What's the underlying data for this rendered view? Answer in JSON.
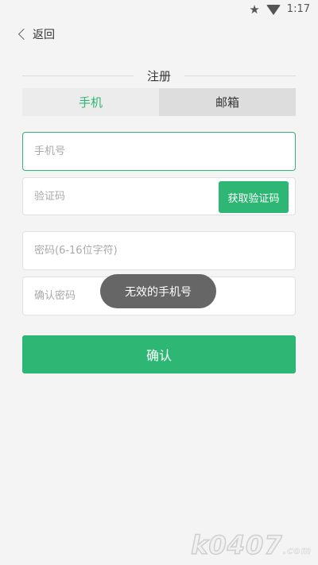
{
  "status_bar": {
    "time": "1:17",
    "icons": [
      "star-icon",
      "wifi-icon"
    ]
  },
  "nav": {
    "back_label": "返回"
  },
  "page": {
    "title": "注册"
  },
  "tabs": [
    {
      "label": "手机",
      "active": true
    },
    {
      "label": "邮箱",
      "active": false
    }
  ],
  "form": {
    "phone_placeholder": "手机号",
    "code_placeholder": "验证码",
    "get_code_label": "获取验证码",
    "password_placeholder": "密码(6-16位字符)",
    "confirm_password_placeholder": "确认密码",
    "submit_label": "确认"
  },
  "toast": {
    "message": "无效的手机号"
  },
  "watermark": {
    "text": "k0407",
    "suffix": ".com"
  },
  "colors": {
    "accent": "#2eb774",
    "background": "#f4f4f4",
    "toast_bg": "#666666"
  }
}
